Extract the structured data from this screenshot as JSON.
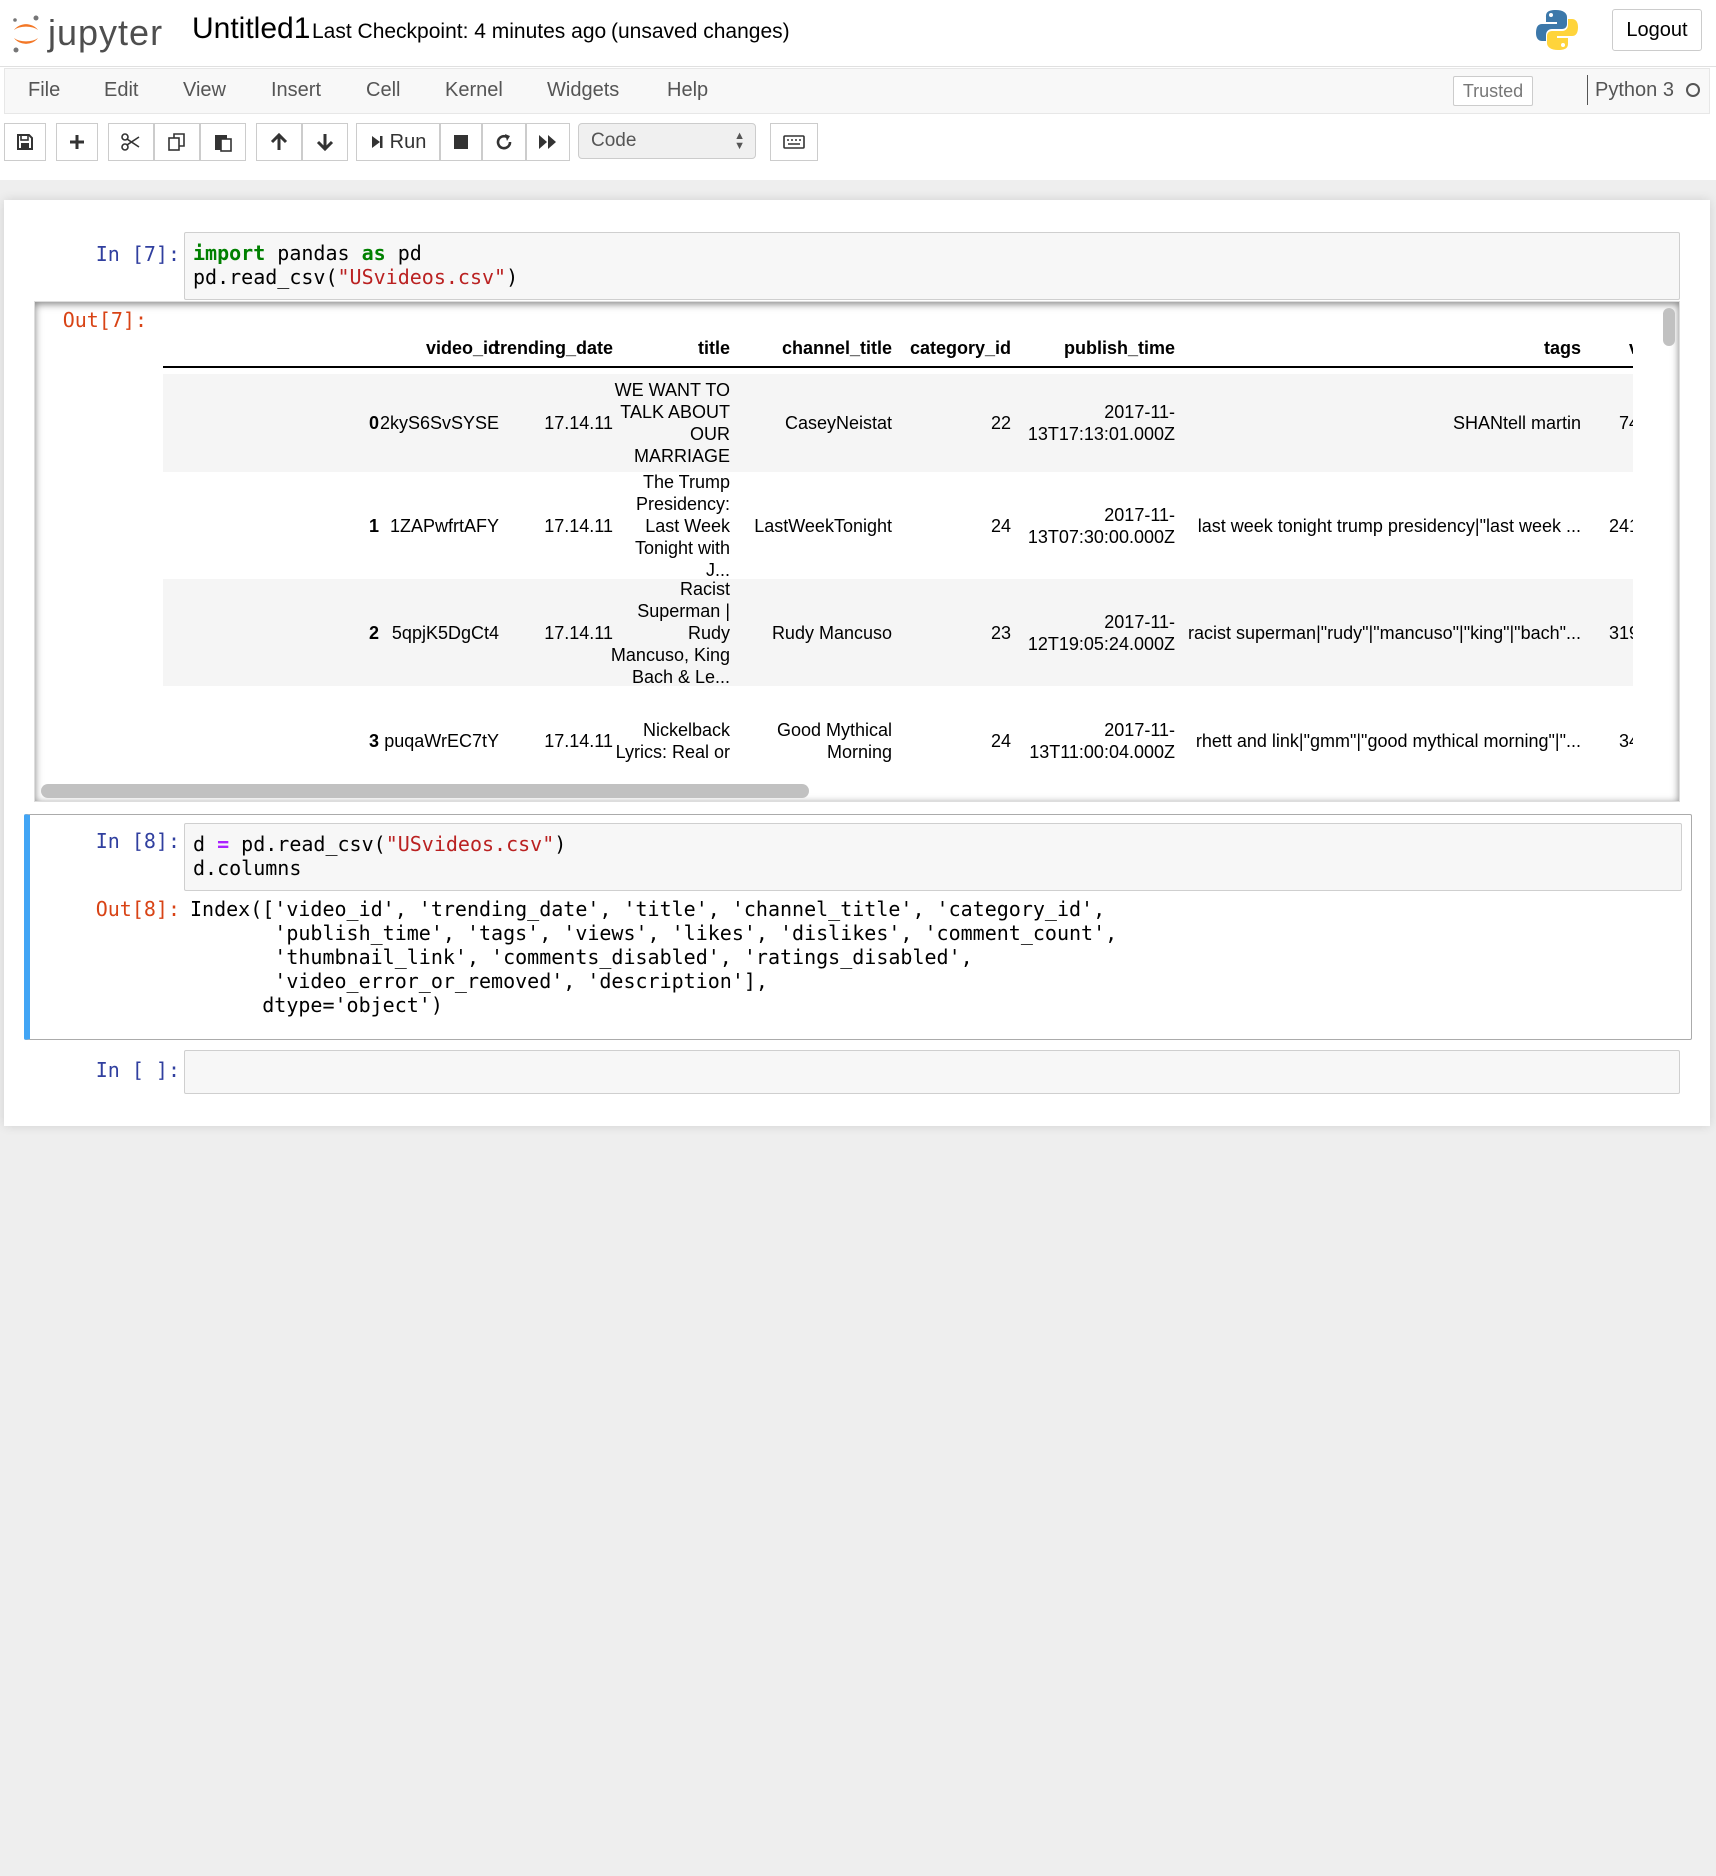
{
  "header": {
    "logo_text": "jupyter",
    "notebook_name": "Untitled1",
    "checkpoint": "Last Checkpoint: 4 minutes ago",
    "unsaved": "(unsaved changes)",
    "logout_label": "Logout"
  },
  "menubar": {
    "items": [
      "File",
      "Edit",
      "View",
      "Insert",
      "Cell",
      "Kernel",
      "Widgets",
      "Help"
    ],
    "trusted_label": "Trusted",
    "kernel_name": "Python 3"
  },
  "toolbar": {
    "run_label": "Run",
    "cell_type": "Code"
  },
  "cells": [
    {
      "in_prompt": "In [7]:",
      "code_line1": {
        "kw1": "import",
        "t1": " pandas ",
        "kw2": "as",
        "t2": " pd"
      },
      "code_line2": {
        "t1": "pd.read_csv(",
        "s": "\"USvideos.csv\"",
        "t2": ")"
      },
      "out_prompt": "Out[7]:"
    },
    {
      "in_prompt": "In [8]:",
      "code_line1": {
        "t1": "d ",
        "op": "=",
        "t2": " pd.read_csv(",
        "s": "\"USvideos.csv\"",
        "t3": ")"
      },
      "code_line2": "d.columns",
      "out_prompt": "Out[8]:",
      "output": "Index(['video_id', 'trending_date', 'title', 'channel_title', 'category_id',\n       'publish_time', 'tags', 'views', 'likes', 'dislikes', 'comment_count',\n       'thumbnail_link', 'comments_disabled', 'ratings_disabled',\n       'video_error_or_removed', 'description'],\n      dtype='object')"
    },
    {
      "in_prompt": "In [ ]:"
    }
  ],
  "dataframe": {
    "columns": [
      "video_id",
      "trending_date",
      "title",
      "channel_title",
      "category_id",
      "publish_time",
      "tags",
      "v"
    ],
    "rows": [
      {
        "index": "0",
        "video_id": "2kyS6SvSYSE",
        "trending_date": "17.14.11",
        "title": [
          "WE WANT TO",
          "TALK ABOUT",
          "OUR",
          "MARRIAGE"
        ],
        "channel_title": [
          "CaseyNeistat"
        ],
        "category_id": "22",
        "publish_time": [
          "2017-11-",
          "13T17:13:01.000Z"
        ],
        "tags": "SHANtell martin",
        "views": "74"
      },
      {
        "index": "1",
        "video_id": "1ZAPwfrtAFY",
        "trending_date": "17.14.11",
        "title": [
          "The Trump",
          "Presidency:",
          "Last Week",
          "Tonight with",
          "J..."
        ],
        "channel_title": [
          "LastWeekTonight"
        ],
        "category_id": "24",
        "publish_time": [
          "2017-11-",
          "13T07:30:00.000Z"
        ],
        "tags": "last week tonight trump presidency|\"last week ...",
        "views": "241"
      },
      {
        "index": "2",
        "video_id": "5qpjK5DgCt4",
        "trending_date": "17.14.11",
        "title": [
          "Racist",
          "Superman |",
          "Rudy",
          "Mancuso, King",
          "Bach & Le..."
        ],
        "channel_title": [
          "Rudy Mancuso"
        ],
        "category_id": "23",
        "publish_time": [
          "2017-11-",
          "12T19:05:24.000Z"
        ],
        "tags": "racist superman|\"rudy\"|\"mancuso\"|\"king\"|\"bach\"...",
        "views": "319"
      },
      {
        "index": "3",
        "video_id": "puqaWrEC7tY",
        "trending_date": "17.14.11",
        "title": [
          "Nickelback",
          "Lyrics: Real or"
        ],
        "channel_title": [
          "Good Mythical",
          "Morning"
        ],
        "category_id": "24",
        "publish_time": [
          "2017-11-",
          "13T11:00:04.000Z"
        ],
        "tags": "rhett and link|\"gmm\"|\"good mythical morning\"|\"...",
        "views": "34"
      }
    ]
  },
  "colors": {
    "prompt_in": "#303f9f",
    "prompt_out": "#d84315",
    "keyword": "#008000",
    "string": "#ba2121",
    "selected_border": "#42a5f5"
  }
}
